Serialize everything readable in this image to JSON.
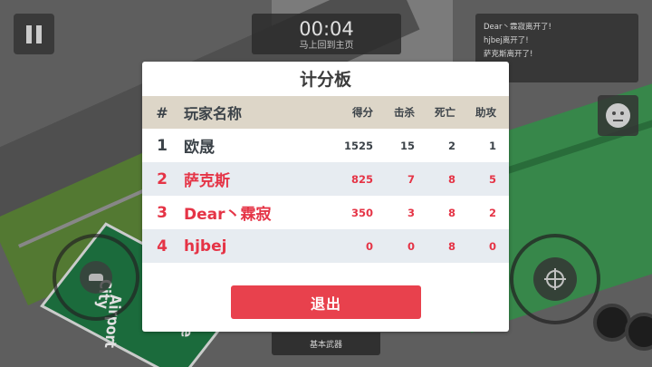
{
  "hud": {
    "timer": "00:04",
    "timer_subtitle": "马上回到主页",
    "killfeed": [
      "Dear丶霖寂离开了!",
      "hjbej离开了!",
      "萨克斯离开了!"
    ],
    "weapon_label": "基本武器"
  },
  "map_sign": {
    "line1": "City",
    "line2": "Airport",
    "line3": "Me"
  },
  "scoreboard": {
    "title": "计分板",
    "headers": {
      "rank": "#",
      "name": "玩家名称",
      "score": "得分",
      "kills": "击杀",
      "deaths": "死亡",
      "assists": "助攻"
    },
    "rows": [
      {
        "rank": "1",
        "name": "欧晟",
        "score": "1525",
        "kills": "15",
        "deaths": "2",
        "assists": "1",
        "team": "mine"
      },
      {
        "rank": "2",
        "name": "萨克斯",
        "score": "825",
        "kills": "7",
        "deaths": "8",
        "assists": "5",
        "team": "enemy"
      },
      {
        "rank": "3",
        "name": "Dear丶霖寂",
        "score": "350",
        "kills": "3",
        "deaths": "8",
        "assists": "2",
        "team": "enemy"
      },
      {
        "rank": "4",
        "name": "hjbej",
        "score": "0",
        "kills": "0",
        "deaths": "8",
        "assists": "0",
        "team": "enemy"
      }
    ],
    "exit_label": "退出"
  },
  "colors": {
    "enemy_text": "#e53446",
    "own_text": "#3c4349",
    "header_bg": "#ddd6c8",
    "exit_button": "#e8414d"
  },
  "icons": [
    "pause-icon",
    "emoji-face-icon",
    "crosshair-icon",
    "joystick-icon"
  ]
}
